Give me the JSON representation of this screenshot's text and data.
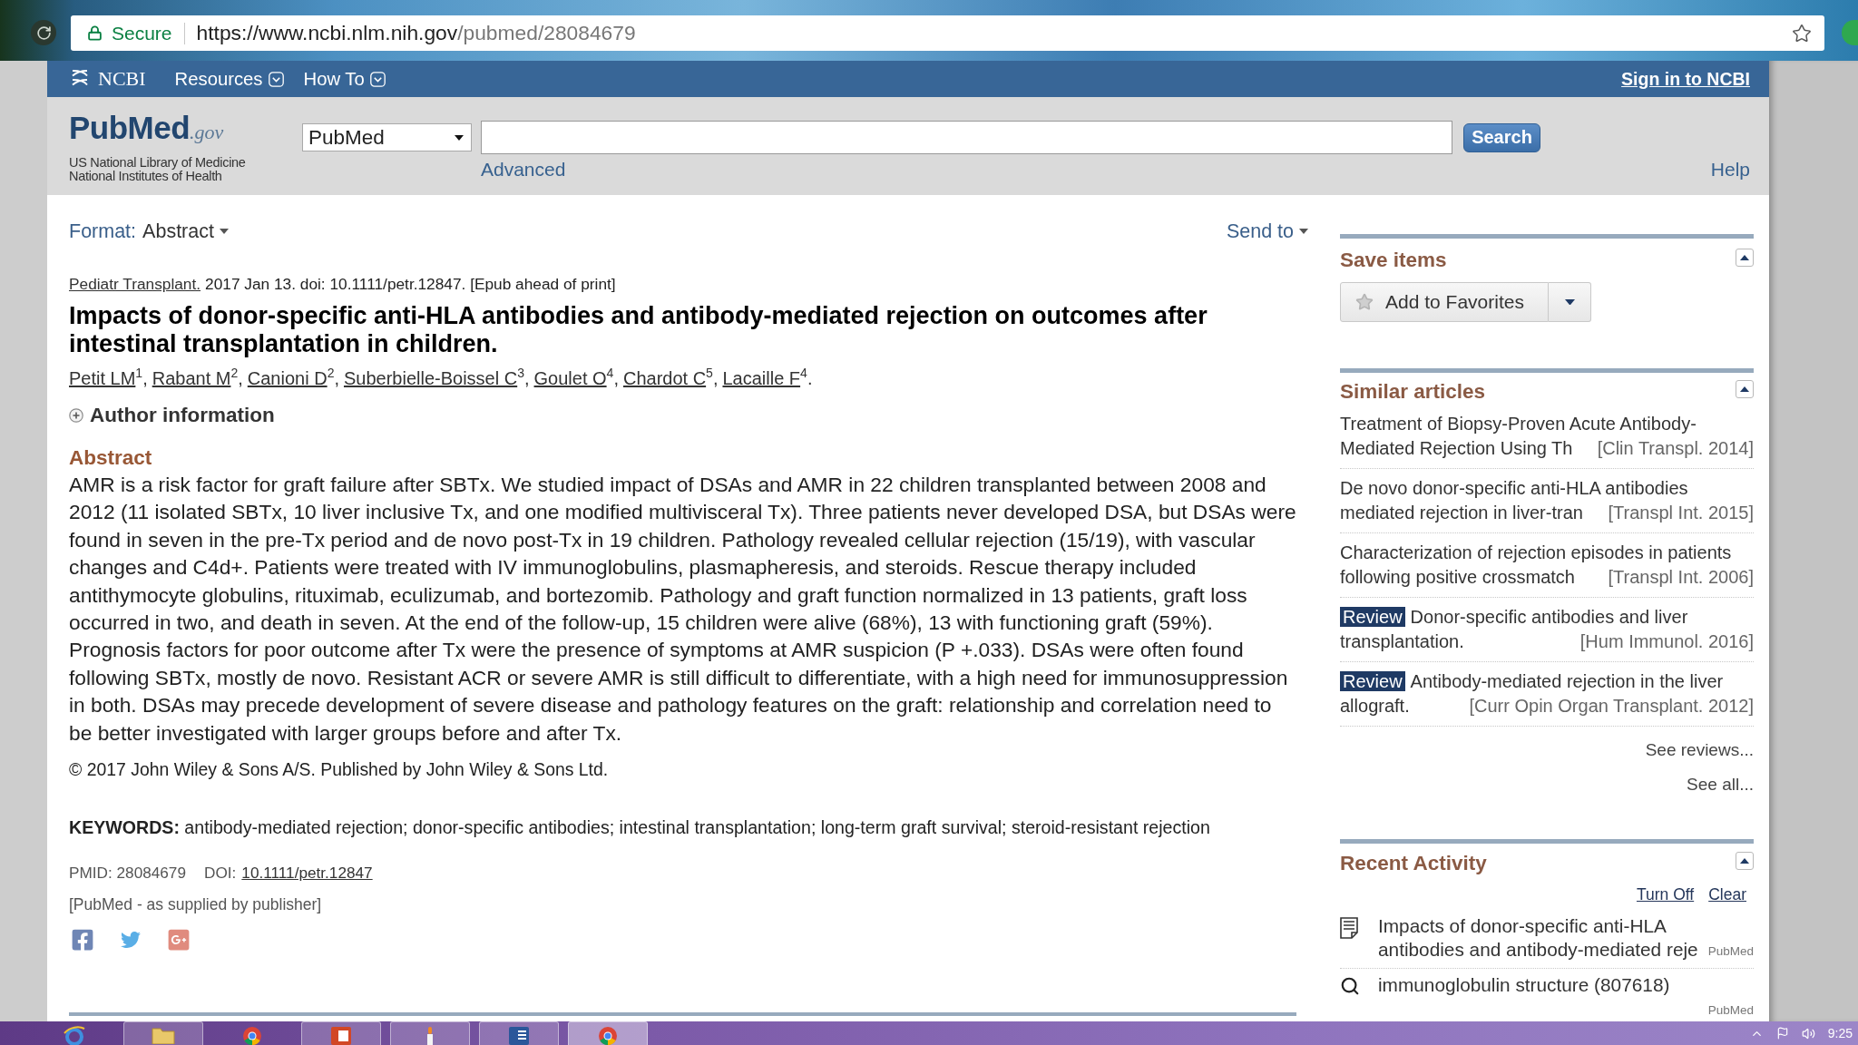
{
  "browser": {
    "security": "Secure",
    "url": {
      "host": "https://www.ncbi.nlm.nih.gov",
      "path": "/pubmed/28084679"
    },
    "bookmarked": false
  },
  "ncbi_bar": {
    "logo": "NCBI",
    "menus": [
      "Resources",
      "How To"
    ],
    "sign_in": "Sign in to NCBI"
  },
  "search_header": {
    "logo": {
      "name": "PubMed",
      "suffix": ".gov"
    },
    "tagline": [
      "US National Library of Medicine",
      "National Institutes of Health"
    ],
    "database": "PubMed",
    "search_button": "Search",
    "advanced": "Advanced",
    "help": "Help"
  },
  "article": {
    "format_label": "Format:",
    "format": "Abstract",
    "send_to": "Send to",
    "citation": {
      "journal": "Pediatr Transplant.",
      "details": "2017 Jan 13. doi: 10.1111/petr.12847. [Epub ahead of print]"
    },
    "title": "Impacts of donor-specific anti-HLA antibodies and antibody-mediated rejection on outcomes after intestinal transplantation in children.",
    "authors": [
      {
        "name": "Petit LM",
        "aff": "1",
        "punct": ","
      },
      {
        "name": "Rabant M",
        "aff": "2",
        "punct": ","
      },
      {
        "name": "Canioni D",
        "aff": "2",
        "punct": ","
      },
      {
        "name": "Suberbielle-Boissel C",
        "aff": "3",
        "punct": ","
      },
      {
        "name": "Goulet O",
        "aff": "4",
        "punct": ","
      },
      {
        "name": "Chardot C",
        "aff": "5",
        "punct": ","
      },
      {
        "name": "Lacaille F",
        "aff": "4",
        "punct": "."
      }
    ],
    "author_info": {
      "label": "Author information",
      "expanded": false
    },
    "abstract": {
      "heading": "Abstract",
      "text": "AMR is a risk factor for graft failure after SBTx. We studied impact of DSAs and AMR in 22 children transplanted between 2008 and 2012 (11 isolated SBTx, 10 liver inclusive Tx, and one modified multivisceral Tx). Three patients never developed DSA, but DSAs were found in seven in the pre-Tx period and de novo post-Tx in 19 children. Pathology revealed cellular rejection (15/19), with vascular changes and C4d+. Patients were treated with IV immunoglobulins, plasmapheresis, and steroids. Rescue therapy included antithymocyte globulins, rituximab, eculizumab, and bortezomib. Pathology and graft function normalized in 13 patients, graft loss occurred in two, and death in seven. At the end of the follow-up, 15 children were alive (68%), 13 with functioning graft (59%). Prognosis factors for poor outcome after Tx were the presence of symptoms at AMR suspicion (P +.033). DSAs were often found following SBTx, mostly de novo. Resistant ACR or severe AMR is still difficult to differentiate, with a high need for immunosuppression in both. DSAs may precede development of severe disease and pathology features on the graft: relationship and correlation need to be better investigated with larger groups before and after Tx.",
      "copyright": "© 2017 John Wiley & Sons A/S. Published by John Wiley & Sons Ltd."
    },
    "keywords": "**KEYWORDS:** antibody-mediated rejection; donor-specific antibodies; intestinal transplantation; long-term graft survival; steroid-resistant rejection",
    "pmid": "PMID: 28084679",
    "doi_label": "DOI:",
    "doi": "10.1111/petr.12847",
    "status": "[PubMed - as supplied by publisher]"
  },
  "sidebar": {
    "save_items": {
      "heading": "Save items",
      "expanded": true,
      "button": "Add to Favorites"
    },
    "similar_articles": {
      "heading": "Similar articles",
      "expanded": true,
      "items": [
        {
          "title": "Treatment of Biopsy-Proven Acute Antibody-Mediated Rejection Using Th",
          "source": "[Clin Transpl. 2014]"
        },
        {
          "title": "De novo donor-specific anti-HLA antibodies mediated rejection in liver-tran",
          "source": "[Transpl Int. 2015]"
        },
        {
          "title": "Characterization of rejection episodes in patients following positive crossmatch",
          "source": "[Transpl Int. 2006]"
        },
        {
          "badge": "Review",
          "title": "Donor-specific antibodies and liver transplantation.",
          "source": "[Hum Immunol. 2016]"
        },
        {
          "badge": "Review",
          "title": "Antibody-mediated rejection in the liver allograft.",
          "source": "[Curr Opin Organ Transplant. 2012]"
        }
      ],
      "links": [
        "See reviews...",
        "See all..."
      ]
    },
    "recent_activity": {
      "heading": "Recent Activity",
      "expanded": true,
      "actions": [
        "Turn Off",
        "Clear"
      ],
      "items": [
        {
          "kind": "article",
          "text": "Impacts of donor-specific anti-HLA antibodies and antibody-mediated reje",
          "source": "PubMed"
        },
        {
          "kind": "search",
          "text": "immunoglobulin structure (807618)",
          "source": "PubMed"
        }
      ]
    }
  },
  "taskbar": {
    "apps": [
      {
        "kind": "ie",
        "open": false,
        "selected": false
      },
      {
        "kind": "folder",
        "open": true,
        "selected": false
      },
      {
        "kind": "chrome",
        "open": false,
        "selected": false
      },
      {
        "kind": "slides",
        "open": true,
        "selected": false
      },
      {
        "kind": "paint",
        "open": true,
        "selected": false
      },
      {
        "kind": "word",
        "open": true,
        "selected": false
      },
      {
        "kind": "chrome",
        "open": true,
        "selected": true
      }
    ],
    "clock": "9:25"
  }
}
